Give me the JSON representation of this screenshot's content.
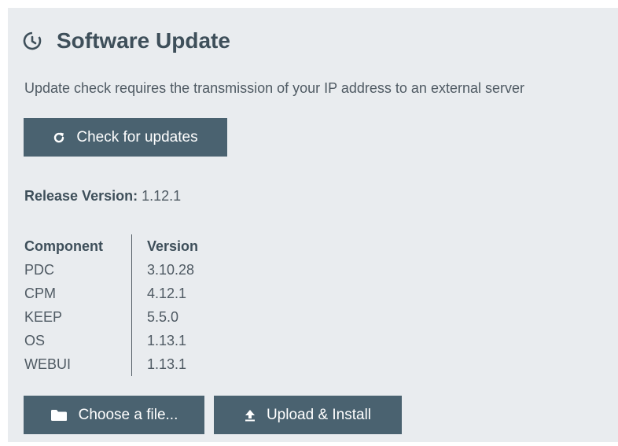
{
  "header": {
    "title": "Software Update",
    "icon": "refresh-circle-icon"
  },
  "notice": {
    "text": "Update check requires the transmission of your IP address to an external server"
  },
  "check_button": {
    "label": "Check for updates",
    "icon": "refresh-icon"
  },
  "release": {
    "label": "Release Version:",
    "value": "1.12.1"
  },
  "components": {
    "headers": [
      "Component",
      "Version"
    ],
    "rows": [
      {
        "component": "PDC",
        "version": "3.10.28"
      },
      {
        "component": "CPM",
        "version": "4.12.1"
      },
      {
        "component": "KEEP",
        "version": "5.5.0"
      },
      {
        "component": "OS",
        "version": "1.13.1"
      },
      {
        "component": "WEBUI",
        "version": "1.13.1"
      }
    ]
  },
  "file_button": {
    "label": "Choose a file...",
    "icon": "folder-icon"
  },
  "upload_button": {
    "label": "Upload & Install",
    "icon": "upload-icon"
  },
  "colors": {
    "panel_bg": "#e9ecef",
    "button_bg": "#4a6270",
    "title": "#3e4f5a",
    "text": "#4f5a63"
  }
}
